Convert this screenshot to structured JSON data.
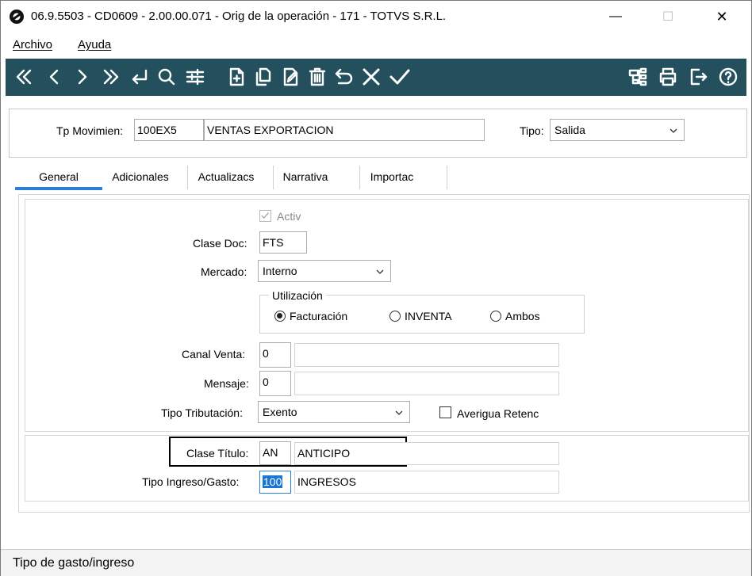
{
  "window": {
    "title": "06.9.5503 - CD0609 - 2.00.00.071 - Orig de la operación - 171 - TOTVS S.R.L.",
    "minimize": "—",
    "maximize": "☐",
    "close": "✕"
  },
  "menu": {
    "archivo": "Archivo",
    "ayuda": "Ayuda"
  },
  "toolbar": {
    "background": "#24505e",
    "icons": [
      "first-icon",
      "previous-icon",
      "next-icon",
      "last-icon",
      "goto-icon",
      "search-icon",
      "filter-icon",
      "new-icon",
      "copy-icon",
      "edit-icon",
      "delete-icon",
      "undo-icon",
      "cancel-icon",
      "confirm-icon",
      "tree-icon",
      "print-icon",
      "exit-icon",
      "help-icon"
    ]
  },
  "header": {
    "tp_movimien_label": "Tp Movimien:",
    "tp_movimien_code": "100EX5",
    "tp_movimien_desc": "VENTAS EXPORTACION",
    "tipo_label": "Tipo:",
    "tipo_value": "Salida"
  },
  "tabs": {
    "general": "General",
    "adicionales": "Adicionales",
    "actualizacs": "Actualizacs",
    "narrativa": "Narrativa",
    "importac": "Importac",
    "active": "General",
    "active_color": "#2b7fd4"
  },
  "general": {
    "activ_label": "Activ",
    "activ_checked": true,
    "clase_doc_label": "Clase Doc:",
    "clase_doc_value": "FTS",
    "mercado_label": "Mercado:",
    "mercado_value": "Interno",
    "utilizacion_label": "Utilización",
    "utilizacion_options": {
      "facturacion": "Facturación",
      "inventa": "INVENTA",
      "ambos": "Ambos"
    },
    "utilizacion_selected": "Facturación",
    "canal_venta_label": "Canal Venta:",
    "canal_venta_value": "0",
    "canal_venta_desc": "",
    "mensaje_label": "Mensaje:",
    "mensaje_value": "0",
    "mensaje_desc": "",
    "tipo_tributacion_label": "Tipo Tributación:",
    "tipo_tributacion_value": "Exento",
    "averigua_retenc_label": "Averigua Retenc",
    "averigua_retenc_checked": false
  },
  "titulo": {
    "clase_titulo_label": "Clase Título:",
    "clase_titulo_code": "AN",
    "clase_titulo_desc": "ANTICIPO",
    "tipo_ingreso_label": "Tipo Ingreso/Gasto:",
    "tipo_ingreso_code": "100",
    "tipo_ingreso_desc": "INGRESOS"
  },
  "status": {
    "text": "Tipo de gasto/ingreso"
  }
}
